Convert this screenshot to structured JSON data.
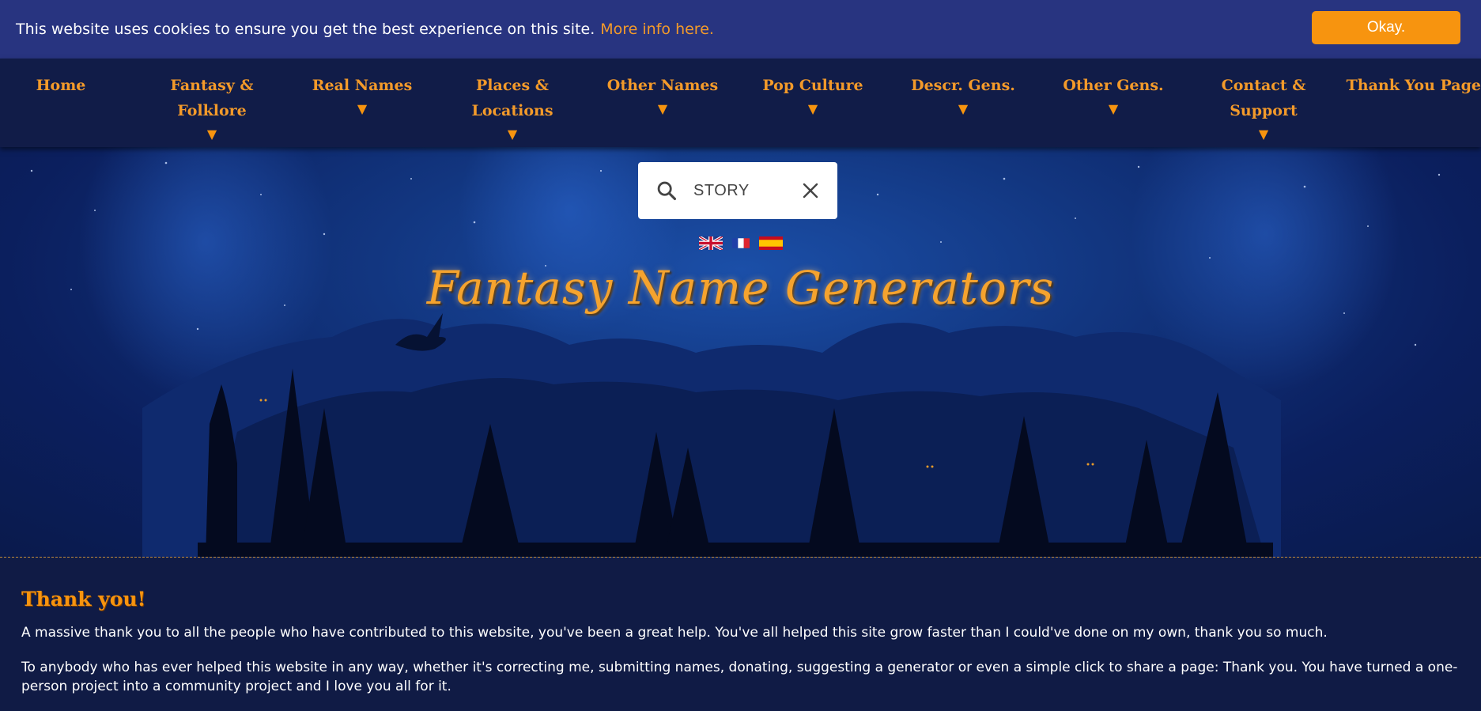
{
  "cookie": {
    "message": "This website uses cookies to ensure you get the best experience on this site.",
    "more_info": "More info here.",
    "ok_label": "Okay."
  },
  "nav": {
    "items": [
      {
        "label": "Home",
        "dropdown": false
      },
      {
        "label": "Fantasy &",
        "label2": "Folklore",
        "dropdown": true
      },
      {
        "label": "Real Names",
        "dropdown": true
      },
      {
        "label": "Places &",
        "label2": "Locations",
        "dropdown": true
      },
      {
        "label": "Other Names",
        "dropdown": true
      },
      {
        "label": "Pop Culture",
        "dropdown": true
      },
      {
        "label": "Descr. Gens.",
        "dropdown": true
      },
      {
        "label": "Other Gens.",
        "dropdown": true
      },
      {
        "label": "Contact &",
        "label2": "Support",
        "dropdown": true
      },
      {
        "label": "Thank You Page",
        "dropdown": false
      }
    ],
    "arrow": "▼"
  },
  "search": {
    "value": "STORY",
    "search_icon": "search-icon",
    "clear_icon": "close-icon"
  },
  "flags": [
    "uk-flag",
    "france-flag",
    "spain-flag"
  ],
  "site_title": "Fantasy Name Generators",
  "content": {
    "title": "Thank you!",
    "paragraphs": [
      "A massive thank you to all the people who have contributed to this website, you've been a great help. You've all helped this site grow faster than I could've done on my own, thank you so much.",
      "To anybody who has ever helped this website in any way, whether it's correcting me, submitting names, donating, suggesting a generator or even a simple click to share a page: Thank you. You have turned a one-person project into a community project and I love you all for it."
    ]
  },
  "colors": {
    "accent": "#f7940f",
    "cookie_bg": "#283480",
    "nav_bg": "#111c48",
    "content_bg": "#101b45"
  }
}
